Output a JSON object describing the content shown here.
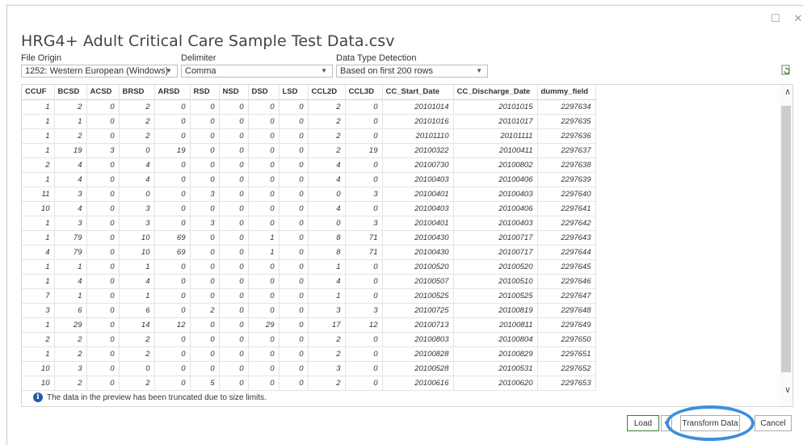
{
  "window": {
    "maximize_glyph": "☐",
    "close_glyph": "✕"
  },
  "title": "HRG4+ Adult Critical Care Sample Test Data.csv",
  "file_origin": {
    "label": "File Origin",
    "value": "1252: Western European (Windows)"
  },
  "delimiter": {
    "label": "Delimiter",
    "value": "Comma"
  },
  "data_type_detection": {
    "label": "Data Type Detection",
    "value": "Based on first 200 rows"
  },
  "refresh_icon": "refresh-icon",
  "table": {
    "columns": [
      "CCUF",
      "BCSD",
      "ACSD",
      "BRSD",
      "ARSD",
      "RSD",
      "NSD",
      "DSD",
      "LSD",
      "CCL2D",
      "CCL3D",
      "CC_Start_Date",
      "CC_Discharge_Date",
      "dummy_field"
    ],
    "rows": [
      [
        "1",
        "2",
        "0",
        "2",
        "0",
        "0",
        "0",
        "0",
        "0",
        "2",
        "0",
        "20101014",
        "20101015",
        "2297634"
      ],
      [
        "1",
        "1",
        "0",
        "2",
        "0",
        "0",
        "0",
        "0",
        "0",
        "2",
        "0",
        "20101016",
        "20101017",
        "2297635"
      ],
      [
        "1",
        "2",
        "0",
        "2",
        "0",
        "0",
        "0",
        "0",
        "0",
        "2",
        "0",
        "20101110",
        "20101111",
        "2297636"
      ],
      [
        "1",
        "19",
        "3",
        "0",
        "19",
        "0",
        "0",
        "0",
        "0",
        "2",
        "19",
        "20100322",
        "20100411",
        "2297637"
      ],
      [
        "2",
        "4",
        "0",
        "4",
        "0",
        "0",
        "0",
        "0",
        "0",
        "4",
        "0",
        "20100730",
        "20100802",
        "2297638"
      ],
      [
        "1",
        "4",
        "0",
        "4",
        "0",
        "0",
        "0",
        "0",
        "0",
        "4",
        "0",
        "20100403",
        "20100406",
        "2297639"
      ],
      [
        "11",
        "3",
        "0",
        "0",
        "0",
        "3",
        "0",
        "0",
        "0",
        "0",
        "3",
        "20100401",
        "20100403",
        "2297640"
      ],
      [
        "10",
        "4",
        "0",
        "3",
        "0",
        "0",
        "0",
        "0",
        "0",
        "4",
        "0",
        "20100403",
        "20100406",
        "2297641"
      ],
      [
        "1",
        "3",
        "0",
        "3",
        "0",
        "3",
        "0",
        "0",
        "0",
        "0",
        "3",
        "20100401",
        "20100403",
        "2297642"
      ],
      [
        "1",
        "79",
        "0",
        "10",
        "69",
        "0",
        "0",
        "1",
        "0",
        "8",
        "71",
        "20100430",
        "20100717",
        "2297643"
      ],
      [
        "4",
        "79",
        "0",
        "10",
        "69",
        "0",
        "0",
        "1",
        "0",
        "8",
        "71",
        "20100430",
        "20100717",
        "2297644"
      ],
      [
        "1",
        "1",
        "0",
        "1",
        "0",
        "0",
        "0",
        "0",
        "0",
        "1",
        "0",
        "20100520",
        "20100520",
        "2297645"
      ],
      [
        "1",
        "4",
        "0",
        "4",
        "0",
        "0",
        "0",
        "0",
        "0",
        "4",
        "0",
        "20100507",
        "20100510",
        "2297646"
      ],
      [
        "7",
        "1",
        "0",
        "1",
        "0",
        "0",
        "0",
        "0",
        "0",
        "1",
        "0",
        "20100525",
        "20100525",
        "2297647"
      ],
      [
        "3",
        "6",
        "0",
        "6",
        "0",
        "2",
        "0",
        "0",
        "0",
        "3",
        "3",
        "20100725",
        "20100819",
        "2297648"
      ],
      [
        "1",
        "29",
        "0",
        "14",
        "12",
        "0",
        "0",
        "29",
        "0",
        "17",
        "12",
        "20100713",
        "20100811",
        "2297649"
      ],
      [
        "2",
        "2",
        "0",
        "2",
        "0",
        "0",
        "0",
        "0",
        "0",
        "2",
        "0",
        "20100803",
        "20100804",
        "2297650"
      ],
      [
        "1",
        "2",
        "0",
        "2",
        "0",
        "0",
        "0",
        "0",
        "0",
        "2",
        "0",
        "20100828",
        "20100829",
        "2297651"
      ],
      [
        "10",
        "3",
        "0",
        "0",
        "0",
        "0",
        "0",
        "0",
        "0",
        "3",
        "0",
        "20100528",
        "20100531",
        "2297652"
      ],
      [
        "10",
        "2",
        "0",
        "2",
        "0",
        "5",
        "0",
        "0",
        "0",
        "2",
        "0",
        "20100616",
        "20100620",
        "2297653"
      ]
    ]
  },
  "info_message": "The data in the preview has been truncated due to size limits.",
  "buttons": {
    "load": "Load",
    "transform": "Transform Data",
    "cancel": "Cancel"
  },
  "colors": {
    "highlight_ring": "#3d8fdc",
    "load_border": "#3b7a3b",
    "info_icon": "#1e5fa8"
  }
}
